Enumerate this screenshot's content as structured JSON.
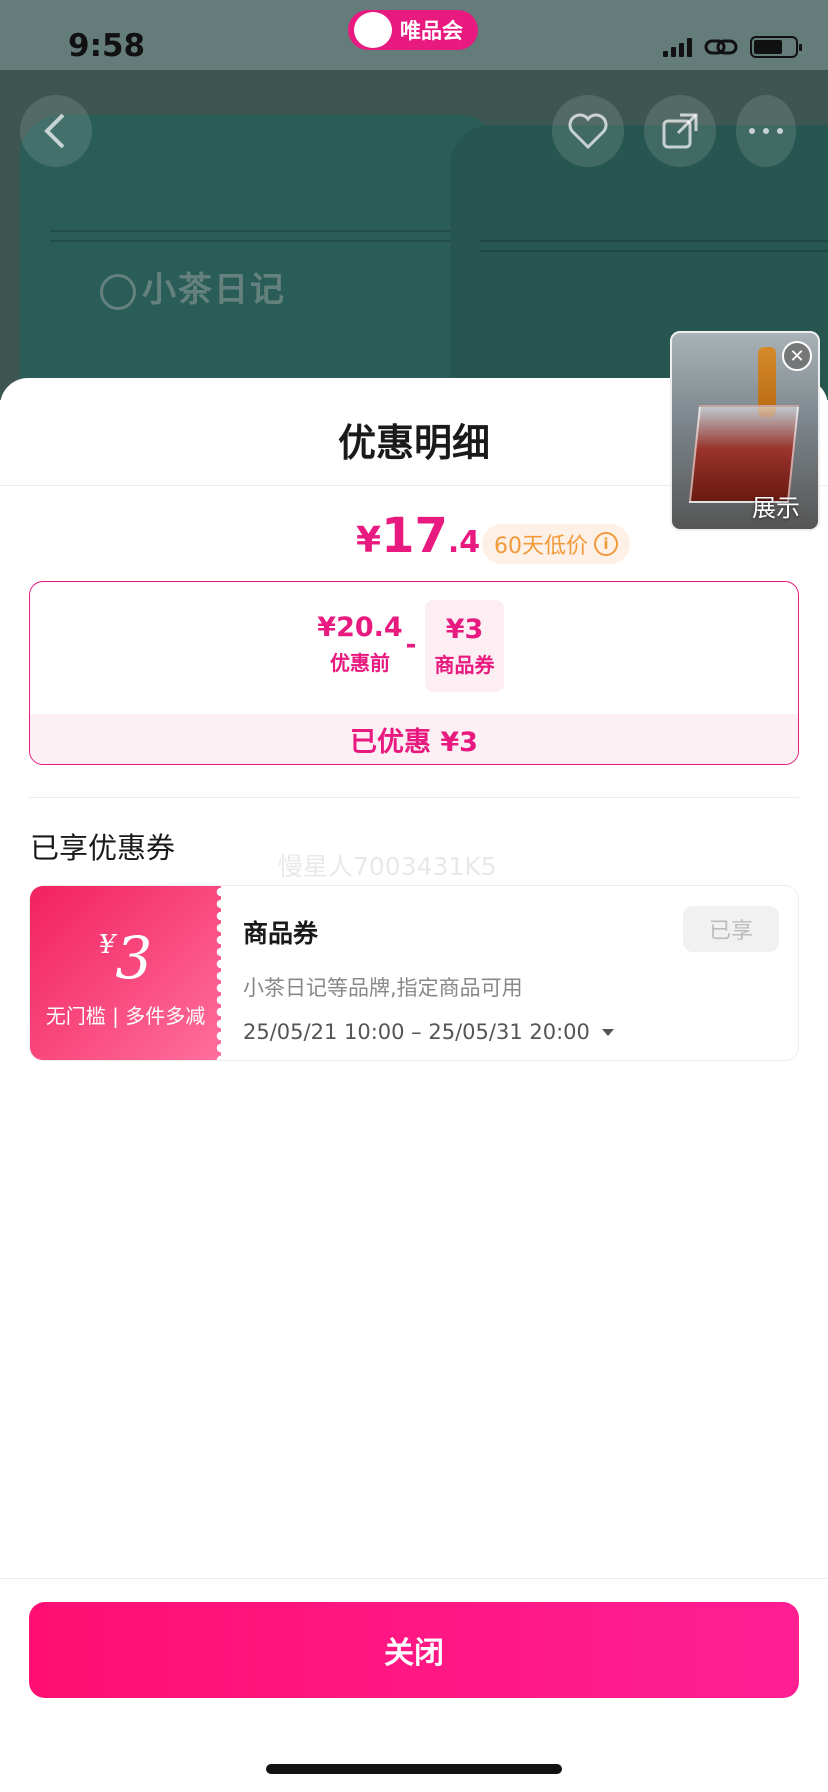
{
  "status_bar": {
    "time": "9:58",
    "app_badge": "唯品会"
  },
  "background": {
    "brand_watermark": "小茶日记",
    "nav_icons": [
      "back-icon",
      "favorite-add-icon",
      "share-icon",
      "more-icon"
    ]
  },
  "floating_video": {
    "label": "展示",
    "close_glyph": "✕"
  },
  "sheet": {
    "title": "优惠明细",
    "final_price": {
      "currency": "¥",
      "integer": "17",
      "decimal": ".4"
    },
    "low_price_badge": "60天低价",
    "info_glyph": "i",
    "calc": {
      "before_value": "¥20.4",
      "before_label": "优惠前",
      "operator": "-",
      "coupon_value": "¥3",
      "coupon_label": "商品券",
      "saved_text": "已优惠 ¥3"
    },
    "section_title": "已享优惠券",
    "watermark": "慢星人7003431K5",
    "coupon": {
      "currency": "¥",
      "amount": "3",
      "condition": "无门槛 | 多件多减",
      "name": "商品券",
      "status": "已享",
      "description": "小茶日记等品牌,指定商品可用",
      "validity": "25/05/21 10:00 – 25/05/31 20:00"
    },
    "close_button": "关闭"
  },
  "colors": {
    "brand": "#e8197f",
    "badge_orange": "#f29a3a"
  }
}
